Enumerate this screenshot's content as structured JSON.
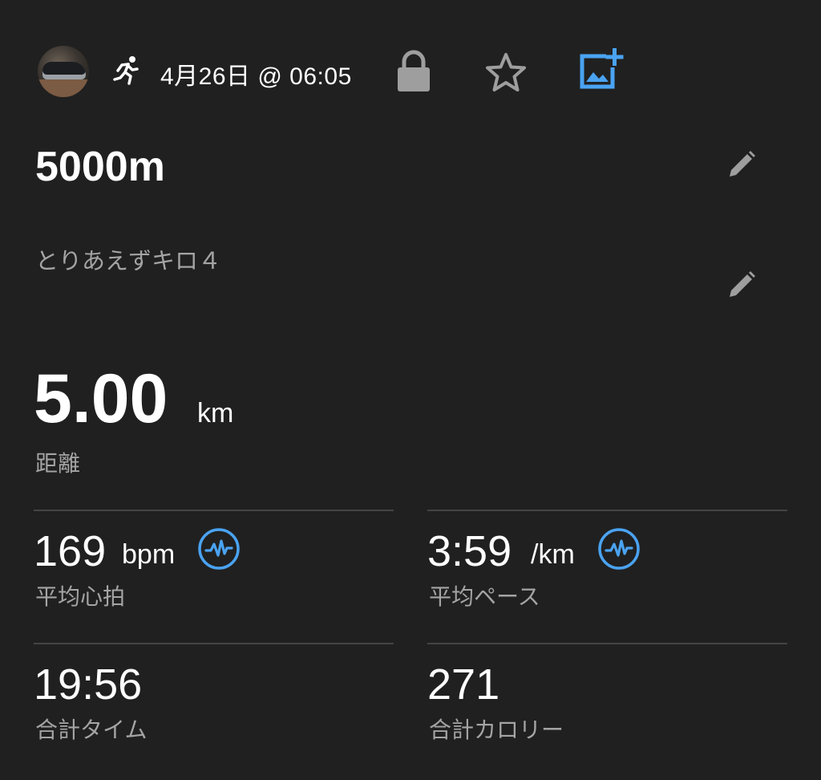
{
  "header": {
    "date": "4月26日 @ 06:05",
    "avatar": "shoe-photo",
    "activity_icon": "running-icon",
    "lock_icon": "lock-icon",
    "favorite_icon": "star-icon",
    "add_photo_icon": "add-photo-icon"
  },
  "activity": {
    "title": "5000m",
    "description": "とりあえずキロ４"
  },
  "distance": {
    "value": "5.00",
    "unit": "km",
    "label": "距離"
  },
  "stats": {
    "avg_hr": {
      "value": "169",
      "unit": "bpm",
      "label": "平均心拍"
    },
    "avg_pace": {
      "value": "3:59",
      "unit": "/km",
      "label": "平均ペース"
    },
    "total_time": {
      "value": "19:56",
      "label": "合計タイム"
    },
    "calories": {
      "value": "271",
      "label": "合計カロリー"
    }
  },
  "colors": {
    "background": "#202020",
    "accent": "#4aa3f2",
    "text": "#ffffff",
    "secondary_text": "#a4a4a4",
    "icon_gray": "#9e9e9e"
  }
}
